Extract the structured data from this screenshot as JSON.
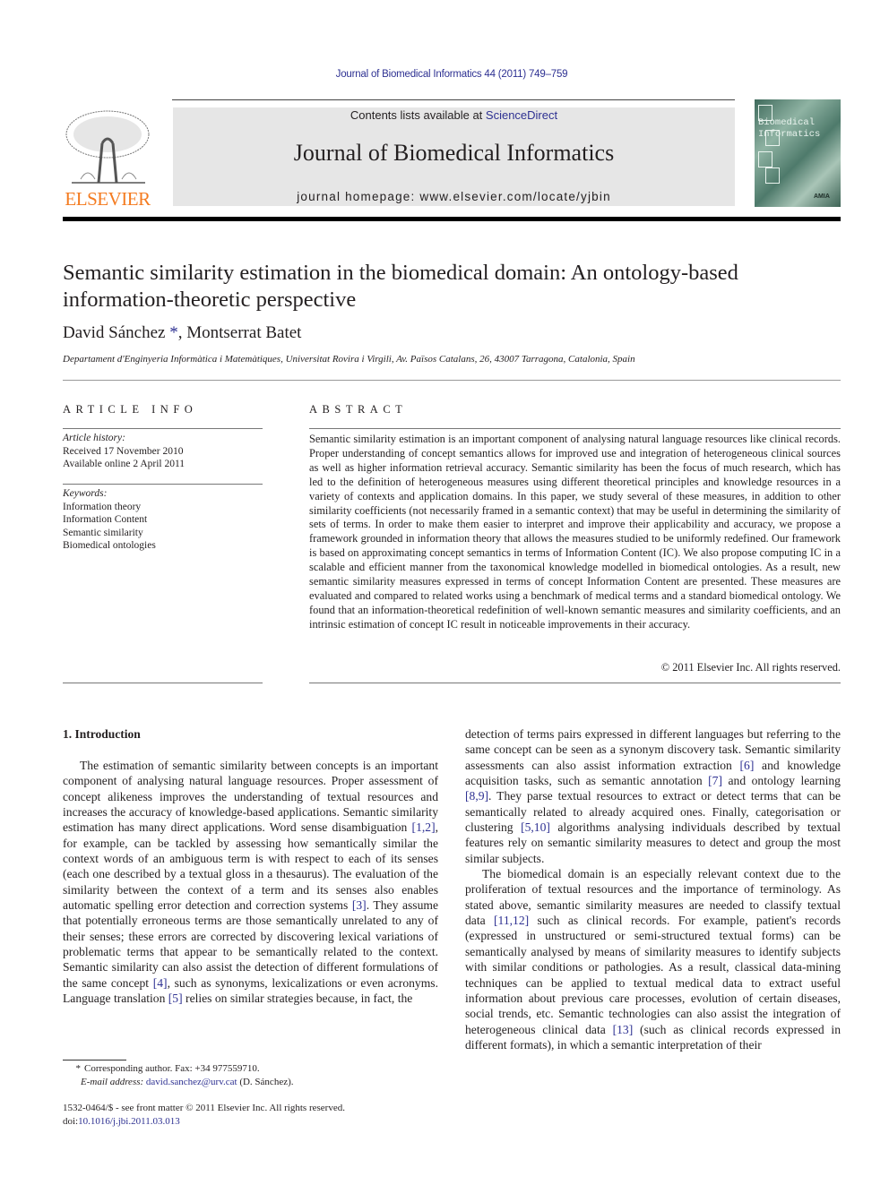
{
  "header": {
    "journal_ref": "Journal of Biomedical Informatics 44 (2011) 749–759",
    "contents_prefix": "Contents lists available at ",
    "contents_link": "ScienceDirect",
    "journal_title": "Journal of Biomedical Informatics",
    "homepage": "journal homepage: www.elsevier.com/locate/yjbin",
    "publisher_logo": "ELSEVIER",
    "cover": {
      "line1": "Biomedical",
      "line2": "Informatics",
      "badge": "AMIA"
    },
    "colors": {
      "link": "#2e3192",
      "publisher": "#f47b20",
      "banner": "#e6e6e6"
    }
  },
  "article": {
    "title_line1": "Semantic similarity estimation in the biomedical domain: An ontology-based",
    "title_line2": "information-theoretic perspective",
    "author1": "David Sánchez",
    "author1_mark": "*",
    "author_sep": ", ",
    "author2": "Montserrat Batet",
    "affiliation": "Departament d'Enginyeria Informàtica i Matemàtiques, Universitat Rovira i Virgili, Av. Països Catalans, 26, 43007 Tarragona, Catalonia, Spain"
  },
  "article_info": {
    "heading": "ARTICLE INFO",
    "history_label": "Article history:",
    "received": "Received 17 November 2010",
    "available": "Available online 2 April 2011",
    "keywords_label": "Keywords:",
    "keywords": [
      "Information theory",
      "Information Content",
      "Semantic similarity",
      "Biomedical ontologies"
    ]
  },
  "abstract": {
    "heading": "ABSTRACT",
    "text": "Semantic similarity estimation is an important component of analysing natural language resources like clinical records. Proper understanding of concept semantics allows for improved use and integration of heterogeneous clinical sources as well as higher information retrieval accuracy. Semantic similarity has been the focus of much research, which has led to the definition of heterogeneous measures using different theoretical principles and knowledge resources in a variety of contexts and application domains. In this paper, we study several of these measures, in addition to other similarity coefficients (not necessarily framed in a semantic context) that may be useful in determining the similarity of sets of terms. In order to make them easier to interpret and improve their applicability and accuracy, we propose a framework grounded in information theory that allows the measures studied to be uniformly redefined. Our framework is based on approximating concept semantics in terms of Information Content (IC). We also propose computing IC in a scalable and efficient manner from the taxonomical knowledge modelled in biomedical ontologies. As a result, new semantic similarity measures expressed in terms of concept Information Content are presented. These measures are evaluated and compared to related works using a benchmark of medical terms and a standard biomedical ontology. We found that an information-theoretical redefinition of well-known semantic measures and similarity coefficients, and an intrinsic estimation of concept IC result in noticeable improvements in their accuracy.",
    "copyright": "© 2011 Elsevier Inc. All rights reserved."
  },
  "body": {
    "section_heading": "1. Introduction",
    "left_p1": [
      "The estimation of semantic similarity between concepts is an important component of analysing natural language resources. Proper assessment of concept alikeness improves the understanding of textual resources and increases the accuracy of knowledge-based applications. Semantic similarity estimation has many direct applications. Word sense disambiguation ",
      "[1,2]",
      ", for example, can be tackled by assessing how semantically similar the context words of an ambiguous term is with respect to each of its senses (each one described by a textual gloss in a thesaurus). The evaluation of the similarity between the context of a term and its senses also enables automatic spelling error detection and correction systems ",
      "[3]",
      ". They assume that potentially erroneous terms are those semantically unrelated to any of their senses; these errors are corrected by discovering lexical variations of problematic terms that appear to be semantically related to the context. Semantic similarity can also assist the detection of different formulations of the same concept ",
      "[4]",
      ", such as synonyms, lexicalizations or even acronyms. Language translation ",
      "[5]",
      " relies on similar strategies because, in fact, the"
    ],
    "right_p1": [
      "detection of terms pairs expressed in different languages but referring to the same concept can be seen as a synonym discovery task. Semantic similarity assessments can also assist information extraction ",
      "[6]",
      " and knowledge acquisition tasks, such as semantic annotation ",
      "[7]",
      " and ontology learning ",
      "[8,9]",
      ". They parse textual resources to extract or detect terms that can be semantically related to already acquired ones. Finally, categorisation or clustering ",
      "[5,10]",
      " algorithms analysing individuals described by textual features rely on semantic similarity measures to detect and group the most similar subjects."
    ],
    "right_p2": [
      "The biomedical domain is an especially relevant context due to the proliferation of textual resources and the importance of terminology. As stated above, semantic similarity measures are needed to classify textual data ",
      "[11,12]",
      " such as clinical records. For example, patient's records (expressed in unstructured or semi-structured textual forms) can be semantically analysed by means of similarity measures to identify subjects with similar conditions or pathologies. As a result, classical data-mining techniques can be applied to textual medical data to extract useful information about previous care processes, evolution of certain diseases, social trends, etc. Semantic technologies can also assist the integration of heterogeneous clinical data ",
      "[13]",
      " (such as clinical records expressed in different formats), in which a semantic interpretation of their"
    ]
  },
  "footnotes": {
    "star": "*",
    "corresponding": "Corresponding author. Fax: +34 977559710.",
    "email_label": "E-mail address: ",
    "email": "david.sanchez@urv.cat",
    "email_suffix": " (D. Sánchez).",
    "front_matter": "1532-0464/$ - see front matter © 2011 Elsevier Inc. All rights reserved.",
    "doi_label": "doi:",
    "doi": "10.1016/j.jbi.2011.03.013"
  }
}
